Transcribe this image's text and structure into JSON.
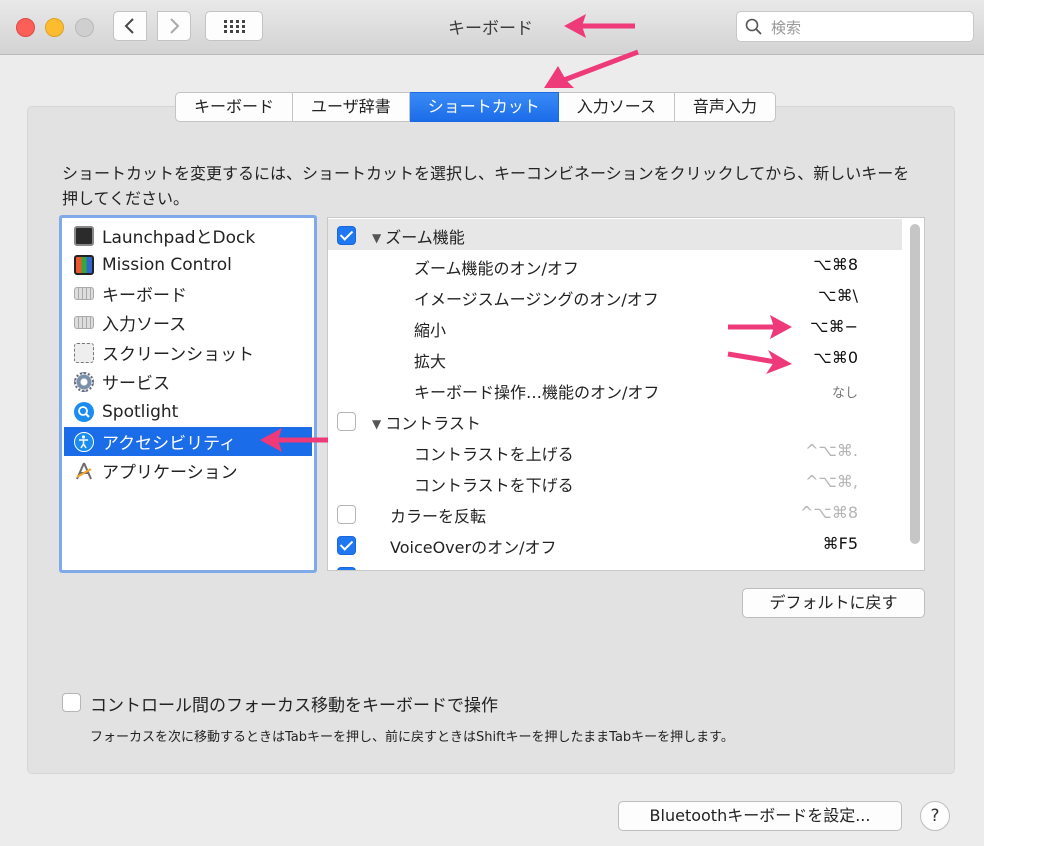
{
  "window": {
    "title": "キーボード"
  },
  "search": {
    "placeholder": "検索"
  },
  "tabs": [
    {
      "label": "キーボード",
      "active": false
    },
    {
      "label": "ユーザ辞書",
      "active": false
    },
    {
      "label": "ショートカット",
      "active": true
    },
    {
      "label": "入力ソース",
      "active": false
    },
    {
      "label": "音声入力",
      "active": false
    }
  ],
  "instruction": "ショートカットを変更するには、ショートカットを選択し、キーコンビネーションをクリックしてから、新しいキーを押してください。",
  "categories": [
    {
      "label": "LaunchpadとDock",
      "icon": "launchpad-icon",
      "selected": false
    },
    {
      "label": "Mission Control",
      "icon": "mission-control-icon",
      "selected": false
    },
    {
      "label": "キーボード",
      "icon": "keyboard-icon",
      "selected": false
    },
    {
      "label": "入力ソース",
      "icon": "input-source-icon",
      "selected": false
    },
    {
      "label": "スクリーンショット",
      "icon": "screenshot-icon",
      "selected": false
    },
    {
      "label": "サービス",
      "icon": "gear-icon",
      "selected": false
    },
    {
      "label": "Spotlight",
      "icon": "spotlight-icon",
      "selected": false
    },
    {
      "label": "アクセシビリティ",
      "icon": "accessibility-icon",
      "selected": true
    },
    {
      "label": "アプリケーション",
      "icon": "app-shortcut-icon",
      "selected": false
    }
  ],
  "shortcuts": [
    {
      "label": "ズーム機能",
      "key": "",
      "checked": true,
      "group": true
    },
    {
      "label": "ズーム機能のオン/オフ",
      "key": "⌥⌘8",
      "indent": true
    },
    {
      "label": "イメージスムージングのオン/オフ",
      "key": "⌥⌘\\",
      "indent": true
    },
    {
      "label": "縮小",
      "key": "⌥⌘−",
      "indent": true
    },
    {
      "label": "拡大",
      "key": "⌥⌘0",
      "indent": true
    },
    {
      "label": "キーボード操作…機能のオン/オフ",
      "key": "なし",
      "indent": true
    },
    {
      "label": "コントラスト",
      "key": "",
      "checked": false,
      "group": true
    },
    {
      "label": "コントラストを上げる",
      "key": "^⌥⌘.",
      "indent": true
    },
    {
      "label": "コントラストを下げる",
      "key": "^⌥⌘,",
      "indent": true
    },
    {
      "label": "カラーを反転",
      "key": "^⌥⌘8",
      "checked": false
    },
    {
      "label": "VoiceOverのオン/オフ",
      "key": "⌘F5",
      "checked": true
    }
  ],
  "buttons": {
    "restore_defaults": "デフォルトに戻す",
    "bluetooth": "Bluetoothキーボードを設定...",
    "help": "?"
  },
  "focus": {
    "label": "コントロール間のフォーカス移動をキーボードで操作",
    "note": "フォーカスを次に移動するときはTabキーを押し、前に戻すときはShiftキーを押したままTabキーを押します。",
    "checked": false
  },
  "colors": {
    "accent": "#1a6ce8",
    "annotation": "#ee3a78"
  }
}
